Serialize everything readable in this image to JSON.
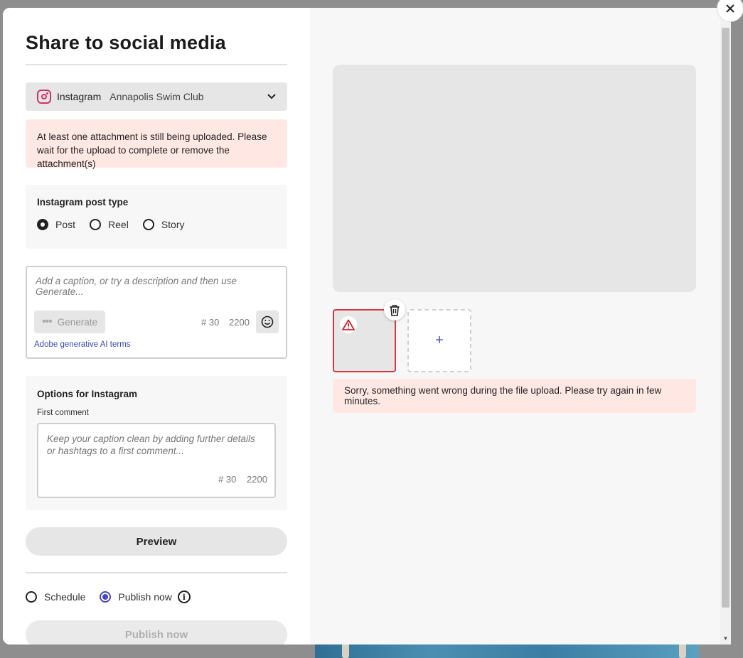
{
  "dialog": {
    "title": "Share to social media",
    "close_icon": "close-icon"
  },
  "account": {
    "platform": "Instagram",
    "name": "Annapolis Swim Club",
    "icon": "instagram-icon"
  },
  "upload_warning": "At least one attachment is still being uploaded. Please wait for the upload to complete or remove the attachment(s)",
  "post_type": {
    "title": "Instagram post type",
    "options": [
      "Post",
      "Reel",
      "Story"
    ],
    "selected": "Post"
  },
  "caption": {
    "placeholder": "Add a caption, or try a description and then use Generate...",
    "generate_label": "Generate",
    "hashtag_count": "# 30",
    "char_count": "2200",
    "ai_terms_link": "Adobe generative AI terms"
  },
  "options": {
    "title": "Options for Instagram",
    "first_comment_label": "First comment",
    "first_comment_placeholder": "Keep your caption clean by adding further details or hashtags to a first comment...",
    "hashtag_count": "# 30",
    "char_count": "2200"
  },
  "preview_button": "Preview",
  "publish_mode": {
    "options": [
      "Schedule",
      "Publish now"
    ],
    "selected": "Publish now"
  },
  "publish_button": "Publish now",
  "media": {
    "add_label": "+",
    "error_message": "Sorry, something went wrong during the file upload. Please try again in few minutes."
  },
  "colors": {
    "accent": "#4646c6",
    "error_border": "#d7373f",
    "alert_bg": "#ffe8e3"
  }
}
